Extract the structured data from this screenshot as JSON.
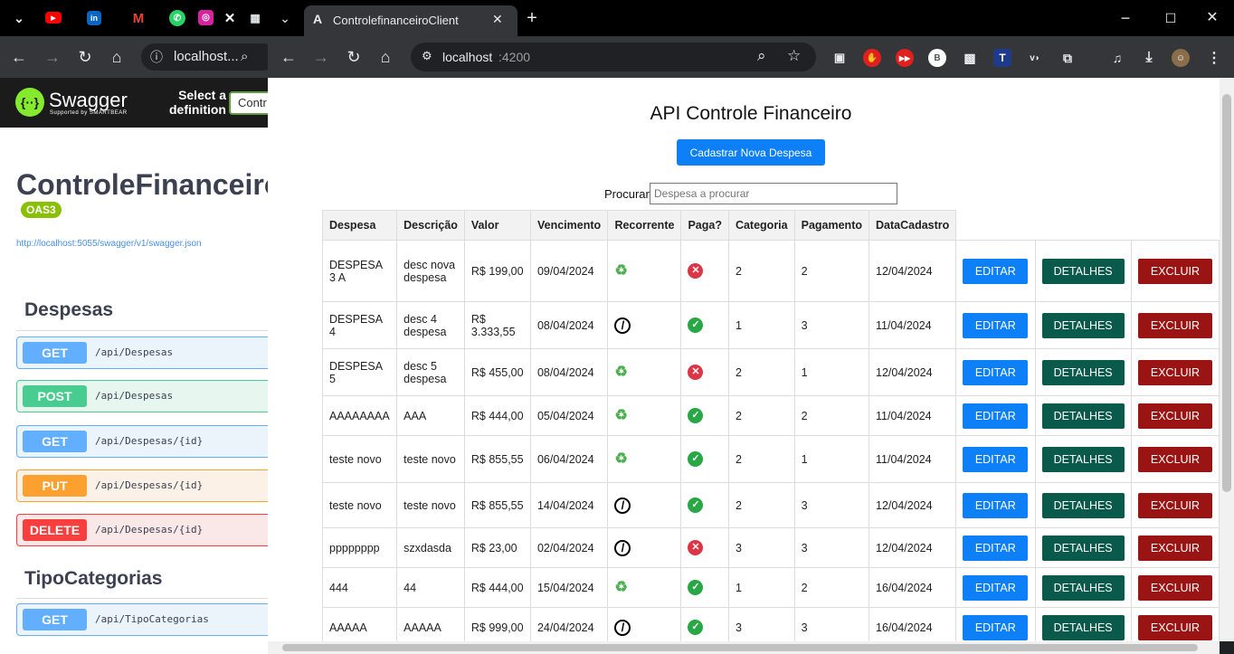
{
  "back_window": {
    "address": "localhost...",
    "swagger_name": "Swagger",
    "swagger_sub": "Supported by SMARTBEAR",
    "select_def": "Select a definition",
    "select_value": "Contr",
    "api_title": "ControleFinanceiro",
    "oas_badge": "OAS3",
    "spec_link": "http://localhost:5055/swagger/v1/swagger.json",
    "section1": "Despesas",
    "section2": "TipoCategorias",
    "ops": [
      {
        "method": "GET",
        "path": "/api/Despesas"
      },
      {
        "method": "POST",
        "path": "/api/Despesas"
      },
      {
        "method": "GET",
        "path": "/api/Despesas/{id}"
      },
      {
        "method": "PUT",
        "path": "/api/Despesas/{id}"
      },
      {
        "method": "DELETE",
        "path": "/api/Despesas/{id}"
      },
      {
        "method": "GET",
        "path": "/api/TipoCategorias"
      }
    ]
  },
  "front_window": {
    "tab_title": "ControlefinanceiroClient",
    "url_host": "localhost",
    "url_port": ":4200"
  },
  "page": {
    "title": "API Controle Financeiro",
    "new_button": "Cadastrar Nova Despesa",
    "search_label": "Procurar",
    "search_placeholder": "Despesa a procurar",
    "headers": [
      "Despesa",
      "Descrição",
      "Valor",
      "Vencimento",
      "Recorrente",
      "Paga?",
      "Categoria",
      "Pagamento",
      "DataCadastro"
    ],
    "btn_edit": "EDITAR",
    "btn_details": "DETALHES",
    "btn_delete": "EXCLUIR",
    "rows": [
      {
        "despesa": "DESPESA 3 A",
        "descricao": "desc nova despesa",
        "valor": "R$ 199,00",
        "vencimento": "09/04/2024",
        "recorrente": true,
        "paga": false,
        "categoria": "2",
        "pagamento": "2",
        "cadastro": "12/04/2024"
      },
      {
        "despesa": "DESPESA 4",
        "descricao": "desc 4 despesa",
        "valor": "R$ 3.333,55",
        "vencimento": "08/04/2024",
        "recorrente": false,
        "paga": true,
        "categoria": "1",
        "pagamento": "3",
        "cadastro": "11/04/2024"
      },
      {
        "despesa": "DESPESA 5",
        "descricao": "desc 5 despesa",
        "valor": "R$ 455,00",
        "vencimento": "08/04/2024",
        "recorrente": true,
        "paga": false,
        "categoria": "2",
        "pagamento": "1",
        "cadastro": "12/04/2024"
      },
      {
        "despesa": "AAAAAAAA",
        "descricao": "AAA",
        "valor": "R$ 444,00",
        "vencimento": "05/04/2024",
        "recorrente": true,
        "paga": true,
        "categoria": "2",
        "pagamento": "2",
        "cadastro": "11/04/2024"
      },
      {
        "despesa": "teste novo",
        "descricao": "teste novo",
        "valor": "R$ 855,55",
        "vencimento": "06/04/2024",
        "recorrente": true,
        "paga": true,
        "categoria": "2",
        "pagamento": "1",
        "cadastro": "11/04/2024"
      },
      {
        "despesa": "teste novo",
        "descricao": "teste novo",
        "valor": "R$ 855,55",
        "vencimento": "14/04/2024",
        "recorrente": false,
        "paga": true,
        "categoria": "2",
        "pagamento": "3",
        "cadastro": "12/04/2024"
      },
      {
        "despesa": "pppppppp",
        "descricao": "szxdasda",
        "valor": "R$ 23,00",
        "vencimento": "02/04/2024",
        "recorrente": false,
        "paga": false,
        "categoria": "3",
        "pagamento": "3",
        "cadastro": "12/04/2024"
      },
      {
        "despesa": "444",
        "descricao": "44",
        "valor": "R$ 444,00",
        "vencimento": "15/04/2024",
        "recorrente": true,
        "paga": true,
        "categoria": "1",
        "pagamento": "2",
        "cadastro": "16/04/2024"
      },
      {
        "despesa": "AAAAA",
        "descricao": "AAAAA",
        "valor": "R$ 999,00",
        "vencimento": "24/04/2024",
        "recorrente": false,
        "paga": true,
        "categoria": "3",
        "pagamento": "3",
        "cadastro": "16/04/2024"
      }
    ]
  },
  "colors": {
    "primary": "#0d7ff7",
    "details": "#0a5a4c",
    "delete": "#9b1414",
    "get": "#61affe",
    "post": "#49cc90",
    "put": "#fca130",
    "del": "#f93e3e"
  }
}
